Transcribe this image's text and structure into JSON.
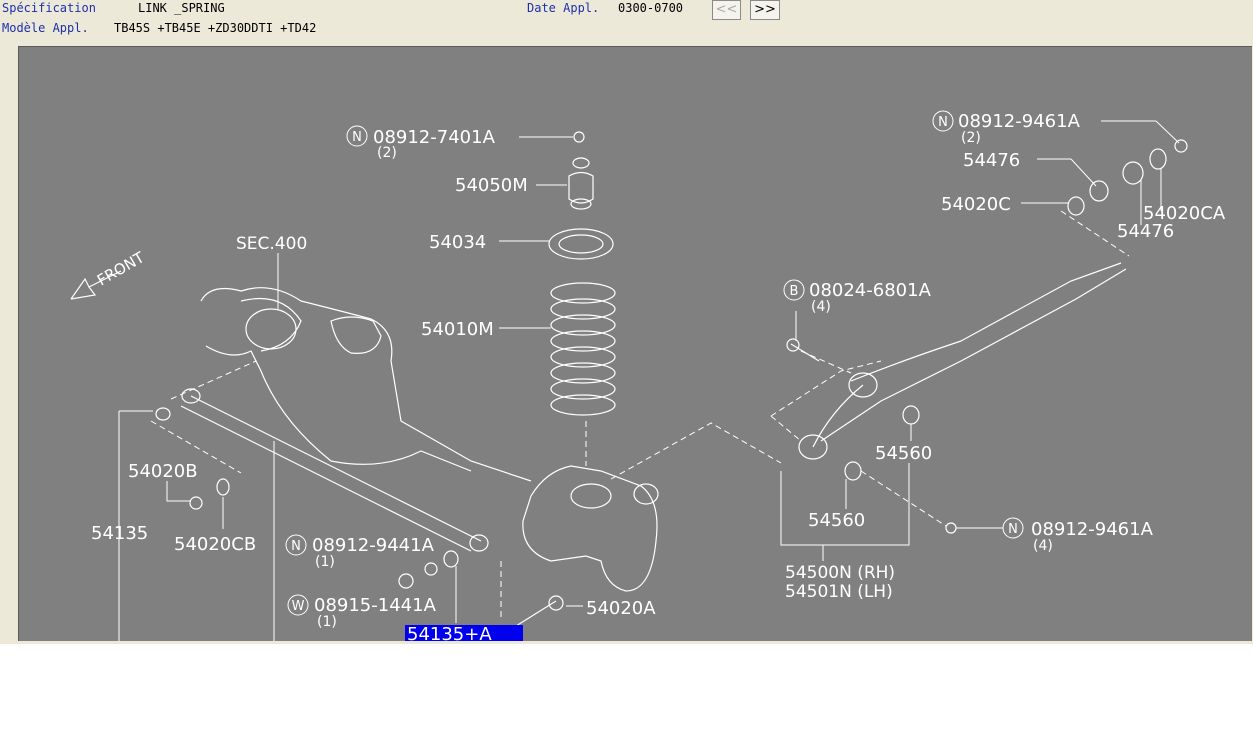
{
  "header": {
    "spec_label": "Spécification",
    "spec_value": "LINK _SPRING",
    "model_label": "Modèle Appl.",
    "model_value": "TB45S +TB45E +ZD30DDTI +TD42",
    "date_label": "Date Appl.",
    "date_value": "0300-0700",
    "prev_label": "<<",
    "next_label": ">>"
  },
  "diagram": {
    "front_label": "FRONT",
    "sec_label": "SEC.400",
    "parts": {
      "p1": "08912-7401A",
      "p1_qty": "(2)",
      "p2": "54050M",
      "p3": "54034",
      "p4": "54010M",
      "p5": "08912-9461A",
      "p5_qty": "(2)",
      "p6": "54476",
      "p7": "54020C",
      "p8": "54020CA",
      "p9": "54476",
      "p10": "08024-6801A",
      "p10_qty": "(4)",
      "p11": "54560",
      "p12": "54560",
      "p13": "08912-9461A",
      "p13_qty": "(4)",
      "p14": "54500N (RH)",
      "p15": "54501N (LH)",
      "p16": "54020B",
      "p17": "54135",
      "p18": "54020CB",
      "p19": "08912-9441A",
      "p19_qty": "(1)",
      "p20": "08915-1441A",
      "p20_qty": "(1)",
      "p21": "54020A",
      "p22": "54135+A"
    },
    "prefix_n": "N",
    "prefix_b": "B",
    "prefix_w": "W"
  },
  "colors": {
    "canvas_bg": "#808080",
    "toolbar_bg": "#ece9d8",
    "label_blue": "#1f2fae",
    "highlight": "#0000ee"
  }
}
